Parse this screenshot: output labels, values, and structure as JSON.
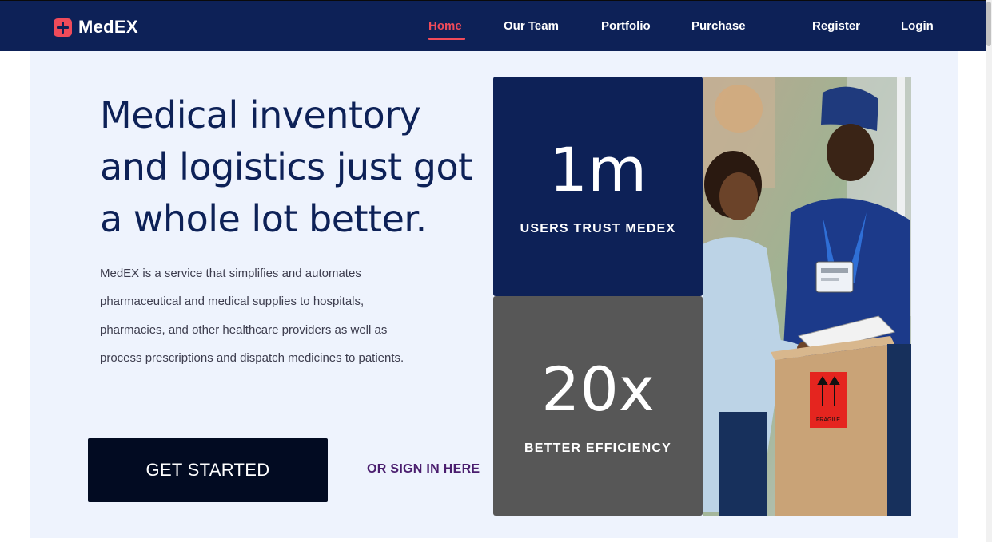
{
  "brand": {
    "name": "MedEX",
    "icon": "plus-icon",
    "accent_color": "#ef4b5a"
  },
  "nav": {
    "background_color": "#0d2157",
    "items": [
      {
        "label": "Home",
        "active": true
      },
      {
        "label": "Our Team",
        "active": false
      },
      {
        "label": "Portfolio",
        "active": false
      },
      {
        "label": "Purchase",
        "active": false
      },
      {
        "label": "Register",
        "active": false
      },
      {
        "label": "Login",
        "active": false
      }
    ]
  },
  "hero": {
    "headline": "Medical inventory and logistics just got a whole lot better.",
    "description": "MedEX is a service that simplifies and automates pharmaceutical and medical supplies to hospitals, pharmacies, and other healthcare providers as well as process prescriptions and dispatch medicines to patients.",
    "cta_label": "GET STARTED",
    "signin_label": "OR SIGN IN HERE"
  },
  "stats": [
    {
      "value": "1m",
      "label": "USERS TRUST MEDEX",
      "color": "#0d2157"
    },
    {
      "value": "20x",
      "label": "BETTER EFFICIENCY",
      "color": "#575757"
    }
  ],
  "photo": {
    "box_label": "FRAGILE"
  }
}
